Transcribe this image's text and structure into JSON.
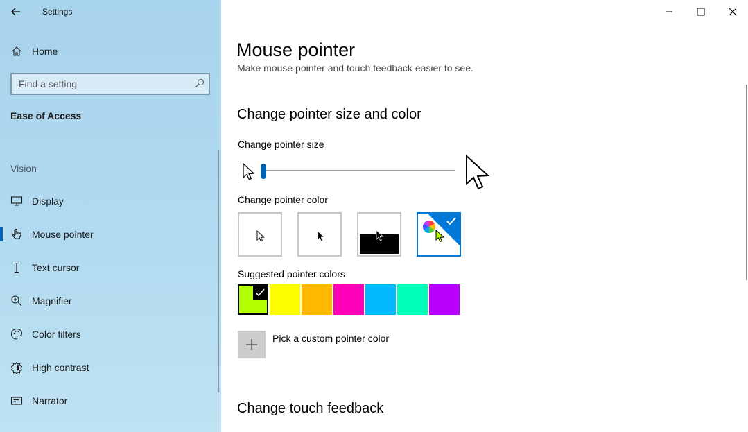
{
  "window": {
    "app_title": "Settings",
    "controls": [
      "minimize",
      "maximize",
      "close"
    ]
  },
  "sidebar": {
    "home_label": "Home",
    "search_placeholder": "Find a setting",
    "section_title": "Ease of Access",
    "group_label": "Vision",
    "items": [
      {
        "label": "Display",
        "icon": "monitor-icon",
        "active": false
      },
      {
        "label": "Mouse pointer",
        "icon": "mouse-pointer-icon",
        "active": true
      },
      {
        "label": "Text cursor",
        "icon": "text-cursor-icon",
        "active": false
      },
      {
        "label": "Magnifier",
        "icon": "magnifier-icon",
        "active": false
      },
      {
        "label": "Color filters",
        "icon": "color-filters-icon",
        "active": false
      },
      {
        "label": "High contrast",
        "icon": "high-contrast-icon",
        "active": false
      },
      {
        "label": "Narrator",
        "icon": "narrator-icon",
        "active": false
      }
    ]
  },
  "main": {
    "page_title": "Mouse pointer",
    "subtitle": "Make mouse pointer and touch feedback easier to see.",
    "section1_heading": "Change pointer size and color",
    "size_label": "Change pointer size",
    "size_slider": {
      "value_fraction": 0.0
    },
    "color_label": "Change pointer color",
    "color_options": [
      "white",
      "black",
      "inverted",
      "custom"
    ],
    "selected_color_option": "custom",
    "suggested_label": "Suggested pointer colors",
    "suggested_colors": [
      "#b4ff00",
      "#ffff00",
      "#ffb900",
      "#ff00b9",
      "#00b9ff",
      "#00ffb9",
      "#b900ff"
    ],
    "selected_suggested_index": 0,
    "custom_color_label": "Pick a custom pointer color",
    "section2_heading": "Change touch feedback"
  },
  "colors": {
    "accent": "#0078d7",
    "slider_thumb": "#0063b1"
  }
}
